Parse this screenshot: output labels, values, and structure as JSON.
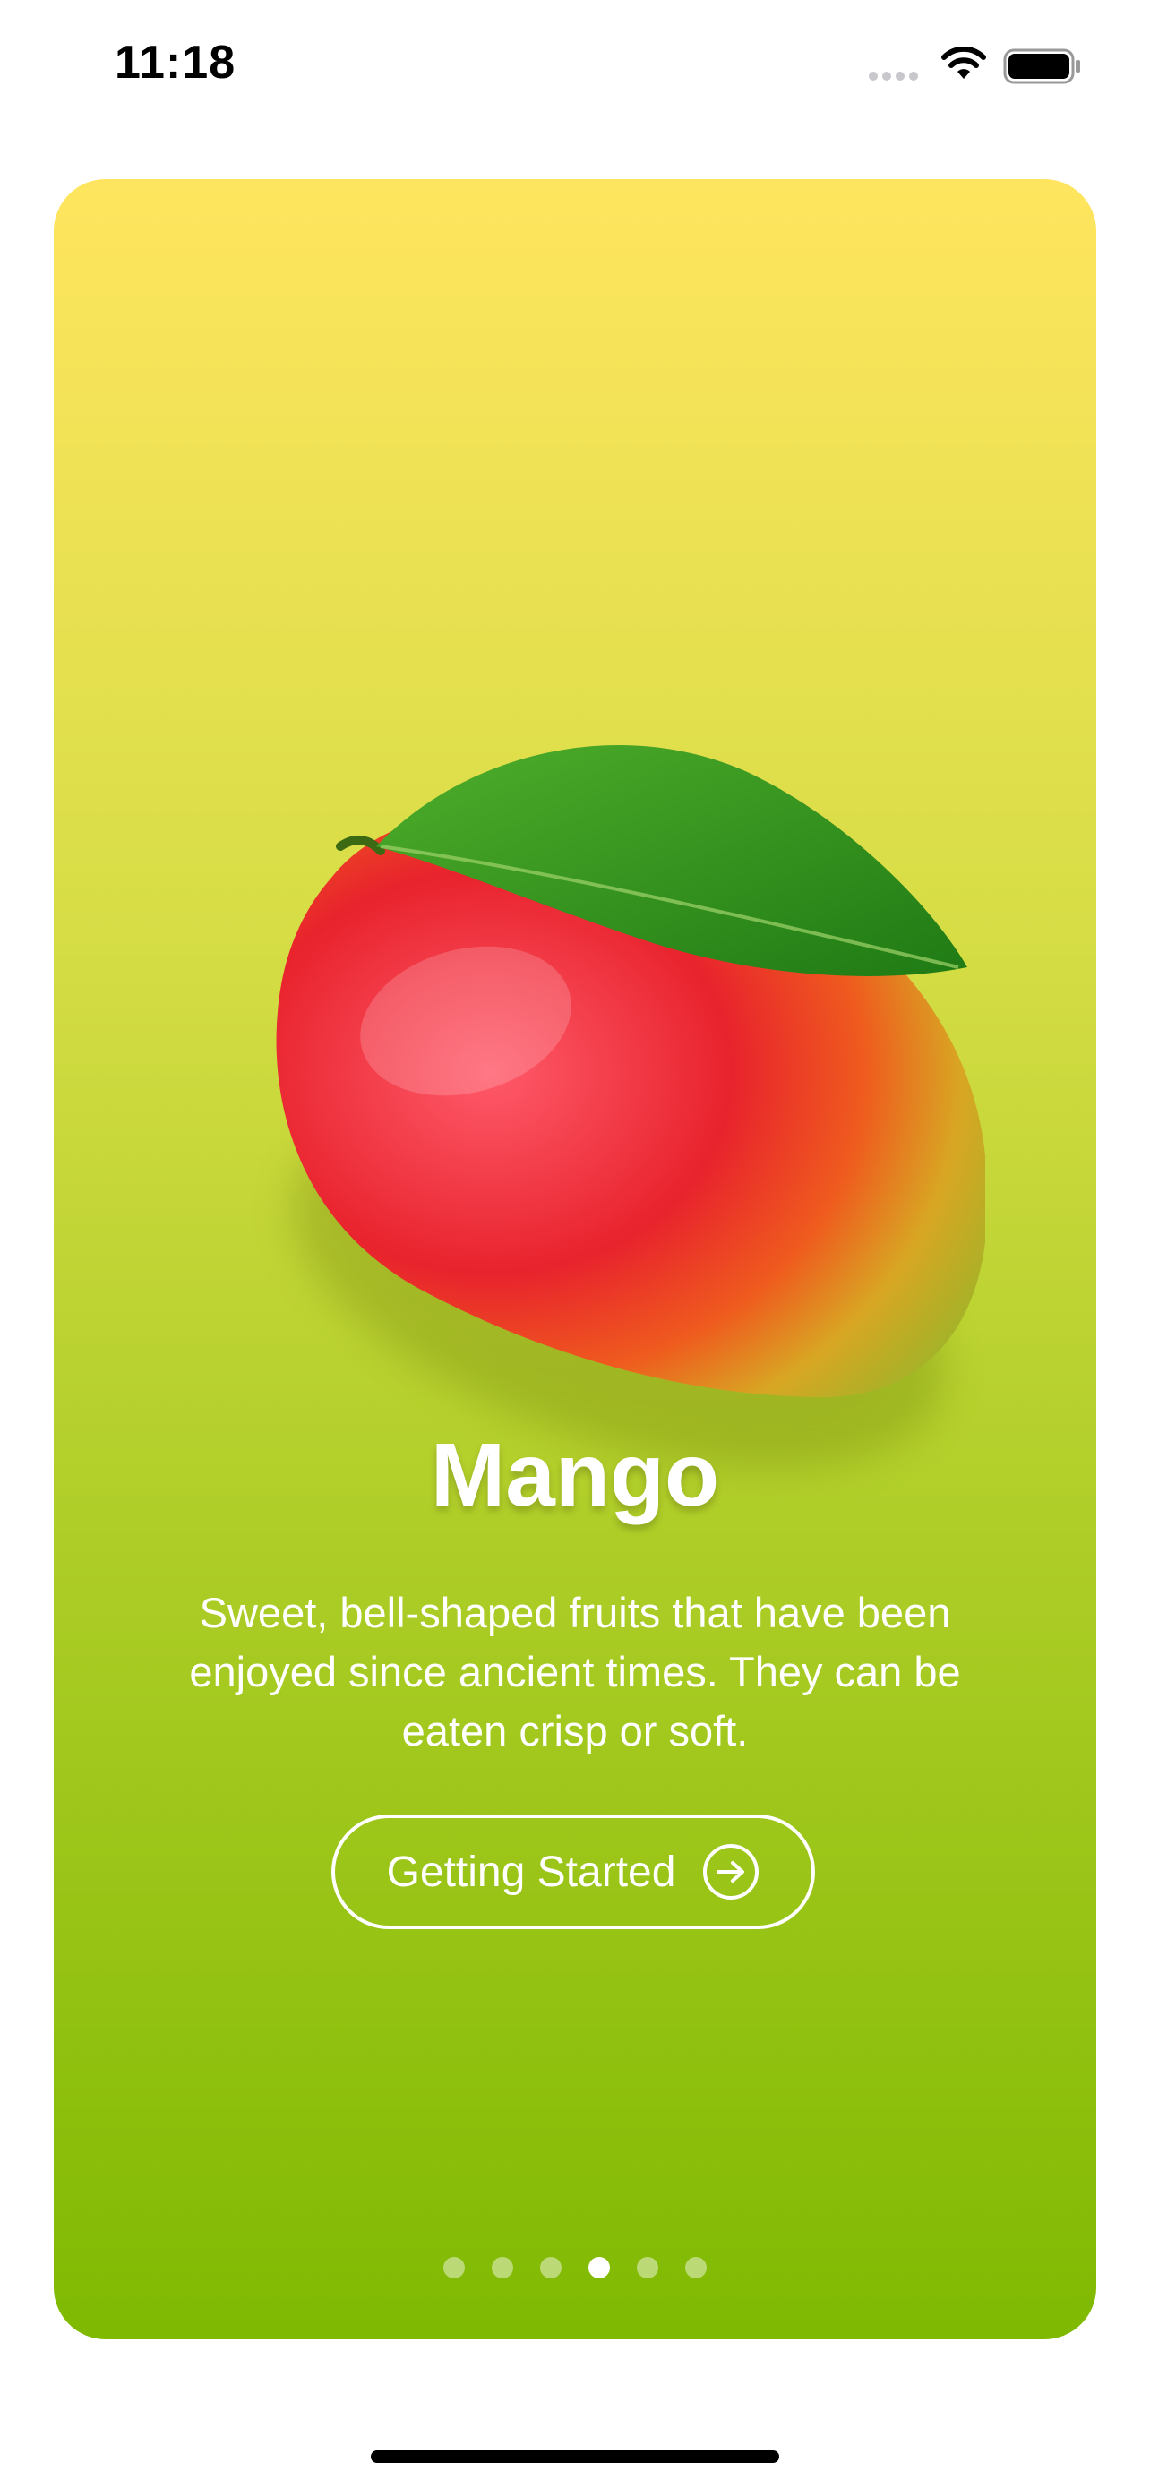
{
  "status_bar": {
    "time": "11:18",
    "icons": [
      "cellular-signal-icon",
      "wifi-icon",
      "battery-icon"
    ]
  },
  "onboarding": {
    "title": "Mango",
    "description": "Sweet, bell-shaped fruits that have been enjoyed since ancient times. They can be eaten crisp or soft.",
    "cta_label": "Getting Started",
    "cta_icon": "arrow-right-circle-icon",
    "gradient_colors": [
      "#FFE55F",
      "#7FB902"
    ],
    "page_indicator": {
      "total": 6,
      "current": 4
    }
  },
  "colors": {
    "text_light": "#FFFFFF",
    "mango_red": "#E8232D",
    "mango_green": "#8DB82A",
    "leaf_green": "#2E8B1E"
  }
}
